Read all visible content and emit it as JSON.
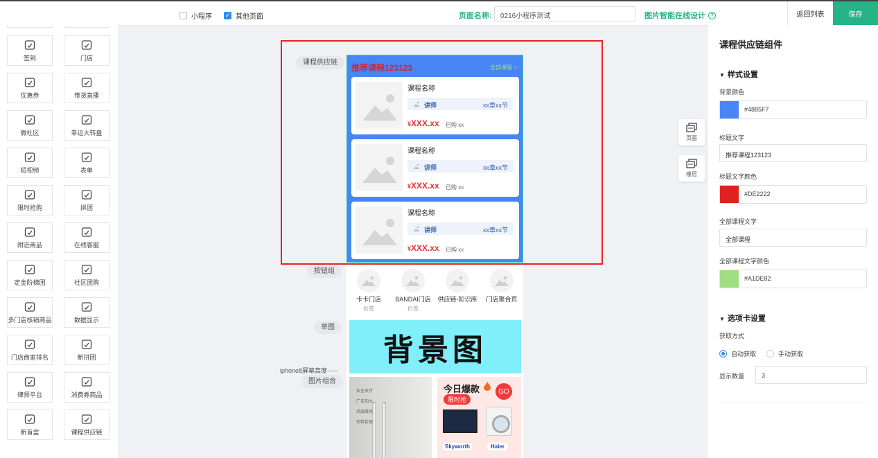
{
  "topbar": {
    "mini_program": "小程序",
    "other_pages": "其他页面",
    "page_name_label": "页面名称:",
    "page_name_value": "0216小程序测试",
    "smart_design": "图片智能在线设计",
    "back_list": "返回列表",
    "save": "保存"
  },
  "components": [
    {
      "label": "签到",
      "icon": "calendar-check-icon"
    },
    {
      "label": "门店",
      "icon": "store-icon"
    },
    {
      "label": "优惠券",
      "icon": "coupon-icon"
    },
    {
      "label": "带货直播",
      "icon": "live-icon"
    },
    {
      "label": "微社区",
      "icon": "planet-icon"
    },
    {
      "label": "幸运大转盘",
      "icon": "wheel-icon"
    },
    {
      "label": "短视频",
      "icon": "play-icon"
    },
    {
      "label": "表单",
      "icon": "form-icon"
    },
    {
      "label": "限时抢购",
      "icon": "lightning-icon"
    },
    {
      "label": "拼团",
      "icon": "group-buy-icon"
    },
    {
      "label": "附近商品",
      "icon": "bag-icon"
    },
    {
      "label": "在线客服",
      "icon": "headset-icon"
    },
    {
      "label": "定金阶梯团",
      "icon": "deposit-icon"
    },
    {
      "label": "社区团购",
      "icon": "community-icon"
    },
    {
      "label": "多门店核销商品",
      "icon": "multi-store-icon"
    },
    {
      "label": "数据显示",
      "icon": "data-grid-icon"
    },
    {
      "label": "门店商家排名",
      "icon": "ranking-icon"
    },
    {
      "label": "新拼团",
      "icon": "new-group-icon"
    },
    {
      "label": "律师平台",
      "icon": "lawyer-icon"
    },
    {
      "label": "消费券商品",
      "icon": "voucher-icon"
    },
    {
      "label": "新盲盒",
      "icon": "gift-box-icon"
    },
    {
      "label": "课程供应链",
      "icon": "book-icon"
    }
  ],
  "canvas_labels": {
    "course": "课程供应链",
    "buttons": "按钮组",
    "single_image": "单图",
    "iphone8": "iphone8屏幕高度-----",
    "image_combo": "图片组合"
  },
  "course": {
    "title": "推荐课程123123",
    "all": "全部课程 >",
    "cards": [
      {
        "name": "课程名称",
        "teacher": "讲师",
        "chapters": "xx章xx节",
        "price": "XXX.xx",
        "currency": "¥",
        "bought": "已购 xx"
      },
      {
        "name": "课程名称",
        "teacher": "讲师",
        "chapters": "xx章xx节",
        "price": "XXX.xx",
        "currency": "¥",
        "bought": "已购 xx"
      },
      {
        "name": "课程名称",
        "teacher": "讲师",
        "chapters": "xx章xx节",
        "price": "XXX.xx",
        "currency": "¥",
        "bought": "已购 xx"
      }
    ]
  },
  "button_group": [
    {
      "name": "卡卡门店",
      "sub": "价签"
    },
    {
      "name": "BANDAI门店",
      "sub": "价签"
    },
    {
      "name": "供应链-知识库",
      "sub": ""
    },
    {
      "name": "门店聚合页",
      "sub": ""
    }
  ],
  "banner_text": "背景图",
  "combo": {
    "left_lines": [
      "安全支付",
      "广告加大",
      "风扇维修",
      "名称拾取"
    ],
    "today": "今日爆款",
    "flash": "限时抢",
    "go": "GO",
    "brand1": "Skyworth",
    "brand2": "Haier"
  },
  "tools": {
    "page": "页面",
    "layers": "楼层"
  },
  "settings": {
    "title": "课程供应链组件",
    "style_section": "样式设置",
    "bg_color_label": "背景颜色",
    "bg_color": "#4885F7",
    "title_text_label": "标题文字",
    "title_text": "推荐课程123123",
    "title_color_label": "标题文字颜色",
    "title_color": "#DE2222",
    "all_text_label": "全部课程文字",
    "all_text": "全部课程",
    "all_color_label": "全部课程文字颜色",
    "all_color": "#A1DE82",
    "tab_section": "选项卡设置",
    "fetch_label": "获取方式",
    "auto": "自动获取",
    "manual": "手动获取",
    "count_label": "显示数量",
    "count": "3"
  }
}
